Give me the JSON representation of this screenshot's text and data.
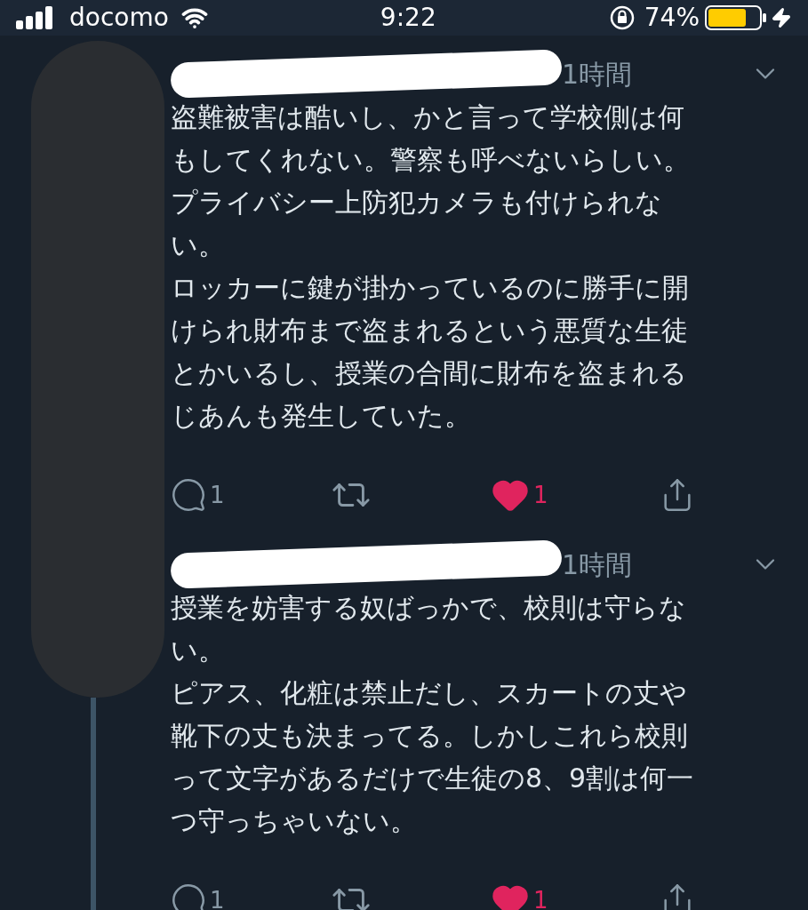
{
  "status_bar": {
    "carrier": "docomo",
    "time": "9:22",
    "battery": "74%"
  },
  "tweets": [
    {
      "time": "1時間",
      "lines": [
        "盗難被害は酷いし、かと言って学校側は何",
        "もしてくれない。警察も呼べないらしい。",
        "プライバシー上防犯カメラも付けられな",
        "い。",
        "ロッカーに鍵が掛かっているのに勝手に開",
        "けられ財布まで盗まれるという悪質な生徒",
        "とかいるし、授業の合間に財布を盗まれる",
        "じあんも発生していた。"
      ],
      "replies": "1",
      "likes": "1",
      "liked": true
    },
    {
      "time": "1時間",
      "lines": [
        "授業を妨害する奴ばっかで、校則は守らな",
        "い。",
        "ピアス、化粧は禁止だし、スカートの丈や",
        "靴下の丈も決まってる。しかしこれら校則",
        "って文字があるだけで生徒の8、9割は何一",
        "つ守っちゃいない。"
      ],
      "replies": "1",
      "likes": "1",
      "liked": true
    }
  ]
}
